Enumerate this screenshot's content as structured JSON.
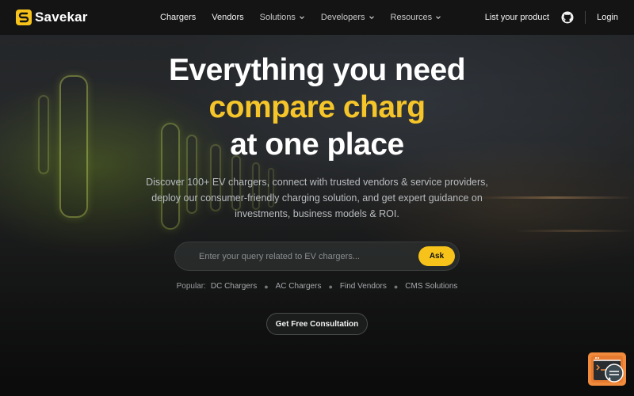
{
  "brand": {
    "name": "Savekar",
    "accent": "#f7c31a"
  },
  "nav": {
    "links": [
      {
        "label": "Chargers",
        "has_dropdown": false
      },
      {
        "label": "Vendors",
        "has_dropdown": false
      },
      {
        "label": "Solutions",
        "has_dropdown": true
      },
      {
        "label": "Developers",
        "has_dropdown": true
      },
      {
        "label": "Resources",
        "has_dropdown": true
      }
    ],
    "list_product": "List your product",
    "login": "Login"
  },
  "hero": {
    "line1": "Everything you need",
    "line2": "compare charg",
    "line3": "at one place",
    "subtitle": "Discover 100+ EV chargers, connect with trusted vendors & service providers, deploy our consumer-friendly charging solution, and get expert guidance on investments, business models & ROI."
  },
  "search": {
    "placeholder": "Enter your query related to EV chargers...",
    "button": "Ask"
  },
  "popular": {
    "label": "Popular:",
    "items": [
      "DC Chargers",
      "AC Chargers",
      "Find Vendors",
      "CMS Solutions"
    ]
  },
  "cta": {
    "consultation": "Get Free Consultation"
  },
  "colors": {
    "highlight": "#f5c52a",
    "background": "#141414",
    "chat_widget": "#f08a3c"
  }
}
